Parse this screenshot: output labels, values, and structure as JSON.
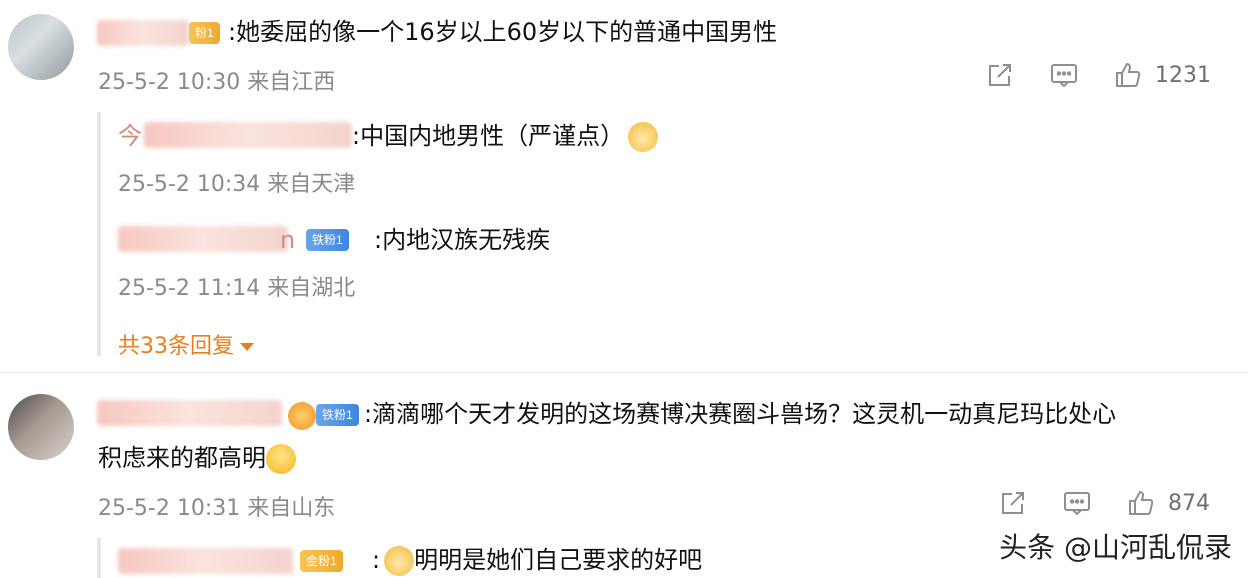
{
  "comments": [
    {
      "text": ":她委屈的像一个16岁以上60岁以下的普通中国男性",
      "meta": "25-5-2 10:30 来自江西",
      "likes": "1231",
      "badge": "粉1",
      "replies": [
        {
          "name_visible": "今",
          "text": ":中国内地男性（严谨点）",
          "meta": "25-5-2 10:34 来自天津"
        },
        {
          "name_visible": "n",
          "badge": "铁粉1",
          "text": ":内地汉族无残疾",
          "meta": "25-5-2 11:14 来自湖北"
        }
      ],
      "more_replies": "共33条回复"
    },
    {
      "text_line1": ":滴滴哪个天才发明的这场赛博决赛圈斗兽场？这灵机一动真尼玛比处心",
      "text_line2": "积虑来的都高明",
      "meta": "25-5-2 10:31 来自山东",
      "likes": "874",
      "badge": "铁粉1",
      "replies": [
        {
          "badge": "金粉1",
          "text": "明明是她们自己要求的好吧"
        }
      ]
    }
  ],
  "watermark": "头条 @山河乱侃录",
  "icons": {
    "share": "share-icon",
    "comment": "comment-icon",
    "like": "thumbs-up-icon",
    "more": "caret-down-icon"
  },
  "colors": {
    "accent": "#e67e22",
    "meta_text": "#8a8a8a",
    "badge_gold": "#f0a92f",
    "badge_blue": "#3f86dc"
  }
}
